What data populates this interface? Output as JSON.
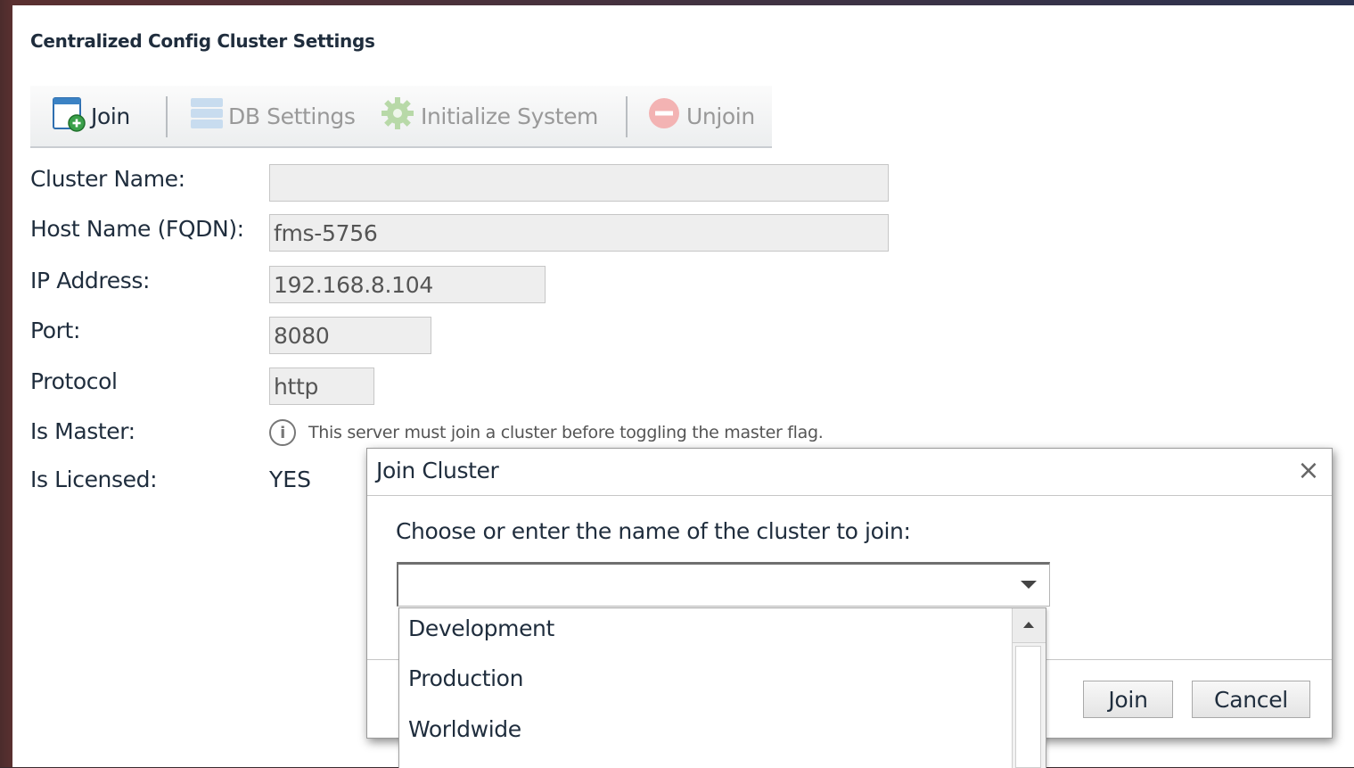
{
  "page": {
    "title": "Centralized Config Cluster Settings"
  },
  "toolbar": {
    "join_label": "Join",
    "db_settings_label": "DB Settings",
    "initialize_label": "Initialize System",
    "unjoin_label": "Unjoin"
  },
  "form": {
    "cluster_name_label": "Cluster Name:",
    "cluster_name_value": "",
    "host_name_label": "Host Name (FQDN):",
    "host_name_value": "fms-5756",
    "ip_label": "IP Address:",
    "ip_value": "192.168.8.104",
    "port_label": "Port:",
    "port_value": "8080",
    "protocol_label": "Protocol",
    "protocol_value": "http",
    "is_master_label": "Is Master:",
    "is_master_info": "This server must join a cluster before toggling the master flag.",
    "is_licensed_label": "Is Licensed:",
    "is_licensed_value": "YES"
  },
  "dialog": {
    "title": "Join Cluster",
    "close_glyph": "×",
    "prompt": "Choose or enter the name of the cluster to join:",
    "combo_value": "",
    "options": [
      "Development",
      "Production",
      "Worldwide"
    ],
    "join_button": "Join",
    "cancel_button": "Cancel"
  },
  "icons": {
    "join": "join-add-icon",
    "db_settings": "database-icon",
    "initialize": "gear-icon",
    "unjoin": "remove-icon",
    "info": "info-icon"
  },
  "colors": {
    "text": "#1f2d3d",
    "disabled_text": "#999999",
    "input_bg": "#eeeeee"
  }
}
